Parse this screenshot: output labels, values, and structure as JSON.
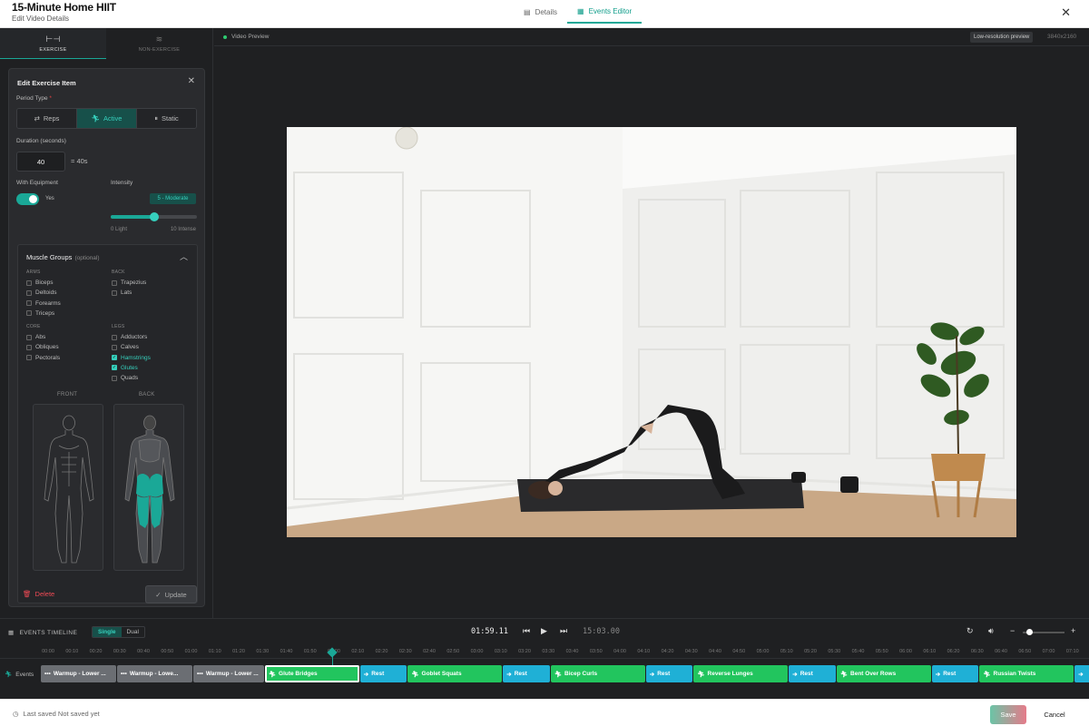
{
  "header": {
    "title": "15-Minute Home HIIT",
    "subtitle": "Edit Video Details",
    "tabs": [
      {
        "label": "Details",
        "icon": "document-icon"
      },
      {
        "label": "Events Editor",
        "icon": "calendar-icon"
      }
    ],
    "active_tab": "Events Editor"
  },
  "sidebar": {
    "tabs": [
      {
        "label": "EXERCISE",
        "icon": "dumbbell-icon"
      },
      {
        "label": "NON-EXERCISE",
        "icon": "layers-icon"
      }
    ],
    "panel": {
      "title": "Edit Exercise Item",
      "period_label": "Period Type",
      "period_required": "*",
      "period_options": [
        "Reps",
        "Active",
        "Static"
      ],
      "period_selected": "Active",
      "duration_label": "Duration (seconds)",
      "duration_value": "40",
      "duration_display": "= 40s",
      "equipment_label": "With Equipment",
      "equipment_value": "Yes",
      "intensity_label": "Intensity",
      "intensity_badge": "5 - Moderate",
      "intensity_level": 5,
      "intensity_max": 10,
      "intensity_min_label": "0 Light",
      "intensity_max_label": "10 Intense",
      "muscle_groups": {
        "title": "Muscle Groups",
        "optional": "(optional)",
        "groups": {
          "arms": {
            "heading": "ARMS",
            "items": [
              {
                "label": "Biceps",
                "checked": false
              },
              {
                "label": "Deltoids",
                "checked": false
              },
              {
                "label": "Forearms",
                "checked": false
              },
              {
                "label": "Triceps",
                "checked": false
              }
            ]
          },
          "back": {
            "heading": "BACK",
            "items": [
              {
                "label": "Trapezius",
                "checked": false
              },
              {
                "label": "Lats",
                "checked": false
              }
            ]
          },
          "core": {
            "heading": "CORE",
            "items": [
              {
                "label": "Abs",
                "checked": false
              },
              {
                "label": "Obliques",
                "checked": false
              },
              {
                "label": "Pectorals",
                "checked": false
              }
            ]
          },
          "legs": {
            "heading": "LEGS",
            "items": [
              {
                "label": "Adductors",
                "checked": false
              },
              {
                "label": "Calves",
                "checked": false
              },
              {
                "label": "Hamstrings",
                "checked": true
              },
              {
                "label": "Glutes",
                "checked": true
              },
              {
                "label": "Quads",
                "checked": false
              }
            ]
          }
        },
        "front_label": "FRONT",
        "back_label": "BACK"
      },
      "delete_label": "Delete",
      "update_label": "Update"
    }
  },
  "preview": {
    "label": "Video Preview",
    "badge": "Low-resolution preview",
    "resolution": "3840x2160"
  },
  "timeline": {
    "label": "EVENTS TIMELINE",
    "modes": [
      "Single",
      "Dual"
    ],
    "mode_selected": "Single",
    "current_time": "01:59.11",
    "total_time": "15:03.00",
    "track_label": "Events",
    "ticks": [
      "00:00",
      "00:10",
      "00:20",
      "00:30",
      "00:40",
      "00:50",
      "01:00",
      "01:10",
      "01:20",
      "01:30",
      "01:40",
      "01:50",
      "02:00",
      "02:10",
      "02:20",
      "02:30",
      "02:40",
      "02:50",
      "03:00",
      "03:10",
      "03:20",
      "03:30",
      "03:40",
      "03:50",
      "04:00",
      "04:10",
      "04:20",
      "04:30",
      "04:40",
      "04:50",
      "05:00",
      "05:10",
      "05:20",
      "05:30",
      "05:40",
      "05:50",
      "06:00",
      "06:10",
      "06:20",
      "06:30",
      "06:40",
      "06:50",
      "07:00",
      "07:10"
    ],
    "events": [
      {
        "label": "Warmup - Lower ...",
        "kind": "warmup",
        "start": 0,
        "end": 32
      },
      {
        "label": "Warmup - Lowe...",
        "kind": "warmup",
        "start": 32,
        "end": 64
      },
      {
        "label": "Warmup - Lower ...",
        "kind": "warmup",
        "start": 64,
        "end": 94
      },
      {
        "label": "Glute Bridges",
        "kind": "exercise",
        "start": 94,
        "end": 134,
        "selected": true
      },
      {
        "label": "Rest",
        "kind": "rest",
        "start": 134,
        "end": 154
      },
      {
        "label": "Goblet Squats",
        "kind": "exercise",
        "start": 154,
        "end": 194
      },
      {
        "label": "Rest",
        "kind": "rest",
        "start": 194,
        "end": 214
      },
      {
        "label": "Bicep Curls",
        "kind": "exercise",
        "start": 214,
        "end": 254
      },
      {
        "label": "Rest",
        "kind": "rest",
        "start": 254,
        "end": 274
      },
      {
        "label": "Reverse Lunges",
        "kind": "exercise",
        "start": 274,
        "end": 314
      },
      {
        "label": "Rest",
        "kind": "rest",
        "start": 314,
        "end": 334
      },
      {
        "label": "Bent Over Rows",
        "kind": "exercise",
        "start": 334,
        "end": 374
      },
      {
        "label": "Rest",
        "kind": "rest",
        "start": 374,
        "end": 394
      },
      {
        "label": "Russian Twists",
        "kind": "exercise",
        "start": 394,
        "end": 434
      },
      {
        "label": "",
        "kind": "rest",
        "start": 434,
        "end": 454
      }
    ],
    "colors": {
      "warmup": "#6b6e73",
      "exercise": "#22c55e",
      "rest": "#1fb0d6",
      "accent": "#1aa897"
    }
  },
  "footer": {
    "saved_label": "Last saved Not saved yet",
    "save_label": "Save",
    "cancel_label": "Cancel"
  }
}
